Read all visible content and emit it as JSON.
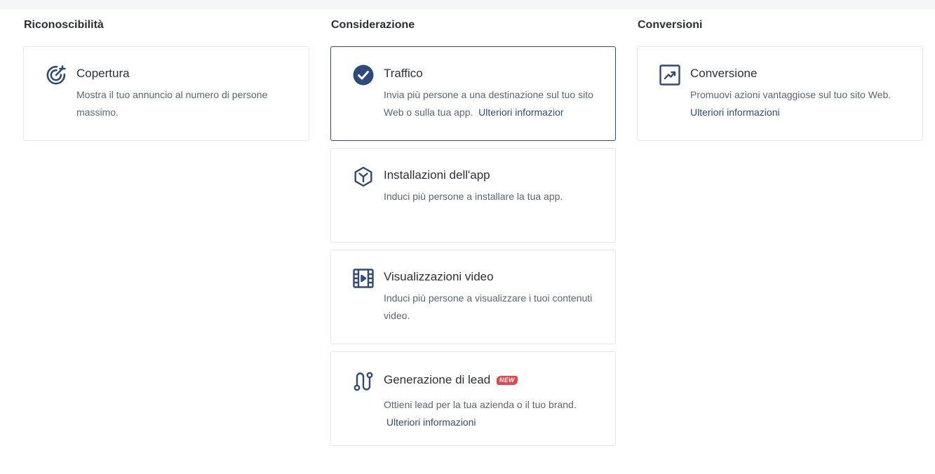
{
  "columns": [
    {
      "title": "Riconoscibilità",
      "cards": [
        {
          "title": "Copertura",
          "description": "Mostra il tuo annuncio al numero di persone massimo.",
          "icon": "target-icon"
        }
      ]
    },
    {
      "title": "Considerazione",
      "cards": [
        {
          "title": "Traffico",
          "description": "Invia più persone a una destinazione sul tuo sito Web o sulla tua app.",
          "link": "Ulteriori informazior",
          "icon": "check-circle-icon",
          "selected": true
        },
        {
          "title": "Installazioni dell'app",
          "description": "Induci più persone a installare la tua app.",
          "icon": "app-cube-icon"
        },
        {
          "title": "Visualizzazioni video",
          "description": "Induci più persone a visualizzare i tuoi contenuti video.",
          "icon": "film-icon"
        },
        {
          "title": "Generazione di lead",
          "badge": "NEW",
          "description": "Ottieni lead per la tua azienda o il tuo brand.",
          "link": "Ulteriori informazioni",
          "icon": "funnel-path-icon"
        }
      ]
    },
    {
      "title": "Conversioni",
      "cards": [
        {
          "title": "Conversione",
          "description": "Promuovi azioni vantaggiose sul tuo sito Web.",
          "link": "Ulteriori informazioni",
          "icon": "trend-chart-icon"
        }
      ]
    }
  ],
  "colors": {
    "accent": "#2e4a7d",
    "border": "#e3e6ea",
    "badge": "#e8454a",
    "text": "#2c2f33",
    "muted": "#5b6470"
  }
}
